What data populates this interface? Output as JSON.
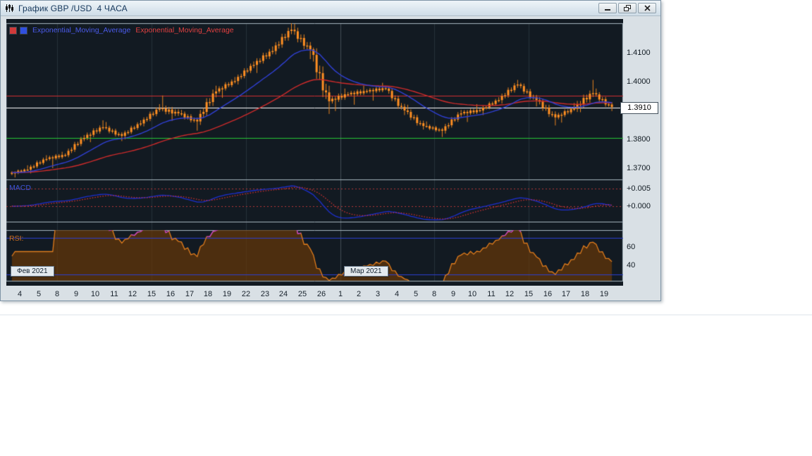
{
  "window": {
    "title": "График GBP /USD  4 ЧАСА",
    "controls": {
      "minimize": "minimize",
      "restore": "restore",
      "close": "close"
    }
  },
  "legend": {
    "items": [
      {
        "label": "Exponential_Moving_Average",
        "color": "#4a5ae8"
      },
      {
        "label": "Exponential_Moving_Average",
        "color": "#e04040"
      }
    ]
  },
  "colors": {
    "panel_bg": "#121a22",
    "panel_border": "#a6b4be",
    "grid": "rgba(180,200,215,0.13)",
    "month_grid": "rgba(190,208,220,0.28)",
    "candle_body": "#ff8f22",
    "candle_wick": "#e8831c",
    "ema_fast": "#2f3fd3",
    "ema_slow": "#cc2a2a",
    "level_red": "#d22f2f",
    "level_white": "#ffffff",
    "level_green": "#25c936",
    "macd_line": "#1d2fd0",
    "macd_signal": "#d63030",
    "macd_levels": "#b23636",
    "rsi_line": "#e07c1c",
    "rsi_overbought": "#bc3ed0",
    "rsi_fill": "rgba(100,54,8,0.72)",
    "rsi_levels": "#2b3fd0"
  },
  "price_axis": {
    "labels": [
      {
        "text": "1.4100",
        "value": 1.41
      },
      {
        "text": "1.4000",
        "value": 1.4
      },
      {
        "text": "1.3800",
        "value": 1.38
      },
      {
        "text": "1.3700",
        "value": 1.37
      }
    ],
    "current": {
      "text": "1.3910",
      "value": 1.391
    }
  },
  "levels": {
    "resistance": 1.395,
    "current": 1.391,
    "support": 1.3805
  },
  "macd": {
    "label": "MACD",
    "axis": [
      {
        "text": "+0.005",
        "value": 0.005
      },
      {
        "text": "+0.000",
        "value": 0.0
      }
    ]
  },
  "rsi": {
    "label": "RSI:",
    "axis": [
      {
        "text": "60",
        "value": 60
      },
      {
        "text": "40",
        "value": 40
      }
    ]
  },
  "months": [
    {
      "label": "Фев 2021",
      "day_index": 0
    },
    {
      "label": "Мар 2021",
      "day_index": 17
    }
  ],
  "chart_data": {
    "type": "candlestick",
    "symbol": "GBP/USD",
    "timeframe": "4 часа",
    "title": "График GBP /USD 4 ЧАСА",
    "ylim": [
      1.3663,
      1.4202
    ],
    "x_labels": [
      "4",
      "5",
      "8",
      "9",
      "10",
      "11",
      "12",
      "15",
      "16",
      "17",
      "18",
      "19",
      "22",
      "23",
      "24",
      "25",
      "26",
      "1",
      "2",
      "3",
      "4",
      "5",
      "8",
      "9",
      "10",
      "11",
      "12",
      "15",
      "16",
      "17",
      "18",
      "19"
    ],
    "grid_day_indices": [
      2,
      7,
      12,
      17,
      22,
      27
    ],
    "month_boundary_index": 17,
    "daily_ohlc": [
      [
        1.368,
        1.371,
        1.3668,
        1.3695
      ],
      [
        1.3695,
        1.3745,
        1.3682,
        1.3732
      ],
      [
        1.3732,
        1.3757,
        1.37,
        1.3745
      ],
      [
        1.3745,
        1.3815,
        1.3738,
        1.3805
      ],
      [
        1.3805,
        1.3866,
        1.379,
        1.3842
      ],
      [
        1.3842,
        1.386,
        1.3794,
        1.3812
      ],
      [
        1.3812,
        1.3866,
        1.38,
        1.3855
      ],
      [
        1.3855,
        1.3922,
        1.3845,
        1.3906
      ],
      [
        1.3906,
        1.3952,
        1.3864,
        1.389
      ],
      [
        1.389,
        1.3902,
        1.383,
        1.3862
      ],
      [
        1.3862,
        1.3986,
        1.385,
        1.3966
      ],
      [
        1.3966,
        1.4016,
        1.3944,
        1.4002
      ],
      [
        1.4002,
        1.407,
        1.399,
        1.4058
      ],
      [
        1.4058,
        1.4122,
        1.403,
        1.4106
      ],
      [
        1.4106,
        1.4206,
        1.4094,
        1.418
      ],
      [
        1.418,
        1.42,
        1.4078,
        1.4112
      ],
      [
        1.4112,
        1.4118,
        1.3888,
        1.3932
      ],
      [
        1.3932,
        1.3976,
        1.3898,
        1.3956
      ],
      [
        1.3956,
        1.3986,
        1.392,
        1.3966
      ],
      [
        1.3966,
        1.3996,
        1.3934,
        1.3976
      ],
      [
        1.3976,
        1.3982,
        1.3884,
        1.39
      ],
      [
        1.39,
        1.392,
        1.3834,
        1.3846
      ],
      [
        1.3846,
        1.3862,
        1.3808,
        1.383
      ],
      [
        1.383,
        1.3902,
        1.382,
        1.389
      ],
      [
        1.389,
        1.3922,
        1.386,
        1.39
      ],
      [
        1.39,
        1.3946,
        1.3884,
        1.3936
      ],
      [
        1.3936,
        1.4006,
        1.3924,
        1.399
      ],
      [
        1.399,
        1.3996,
        1.3914,
        1.3936
      ],
      [
        1.3936,
        1.3946,
        1.3848,
        1.3876
      ],
      [
        1.3876,
        1.3926,
        1.3858,
        1.3906
      ],
      [
        1.3906,
        1.4006,
        1.3894,
        1.396
      ],
      [
        1.396,
        1.3976,
        1.3898,
        1.3912
      ]
    ],
    "indicators": {
      "ema_fast_period": 20,
      "ema_slow_period": 60,
      "macd": {
        "fast": 12,
        "slow": 26,
        "signal": 9,
        "levels": [
          0.005,
          0.0
        ]
      },
      "rsi": {
        "period": 14,
        "levels": [
          70,
          30
        ]
      }
    }
  }
}
